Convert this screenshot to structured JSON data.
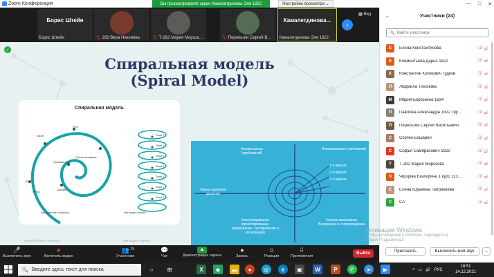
{
  "window": {
    "title": "Zoom Конференция",
    "share_banner": "Вы просматриваете экран Камалетдиновы Эля 1822",
    "view_options": "Настройки просмотра ⌄",
    "controls": [
      "—",
      "□",
      "✕"
    ]
  },
  "strip": {
    "tiles": [
      {
        "big": "Борис Штейн",
        "caption": "Борис Штейн",
        "muted": false,
        "kind": "name"
      },
      {
        "big": "",
        "caption": "282 Вера Никонова",
        "muted": true,
        "kind": "face",
        "color": "#7a3b2e"
      },
      {
        "big": "",
        "caption": "Т-282 Мария Морозо...",
        "muted": true,
        "kind": "face",
        "color": "#5c5b58"
      },
      {
        "big": "",
        "caption": "Перельгин Сергей В...",
        "muted": true,
        "kind": "face",
        "color": "#556b55"
      },
      {
        "big": "Камалетдинова...",
        "caption": "Камалетдинова Эля 1822",
        "muted": false,
        "kind": "name"
      }
    ],
    "view_label": "Вид"
  },
  "slide": {
    "title_line1": "Спиральная модель",
    "title_line2": "(Spiral Model)",
    "left_card": {
      "title": "Спиральная модель",
      "spiral_labels": [
        "Тест",
        "Зачёт",
        "Проектирование",
        "Требования",
        "Дизайн",
        "HTML",
        "JS"
      ],
      "coil_labels": [
        "Этап 7",
        "Этап 6",
        "Этап 5",
        "Этап 4",
        "Этап 3",
        "Этап 2",
        "Этап 1"
      ],
      "caption_left": "Как работает юзнутра",
      "caption_right": "Как видит клиент"
    },
    "right_card": {
      "top_left": "Анализ риска (требований)",
      "top_right": "Формирование требований",
      "versions": [
        "1-я версия",
        "2-я версия",
        "3-я версия"
      ],
      "left": "Линия принятия решения",
      "bottom_left": "Конструирование (проектирование, кодирование, тестирование и интеграция)",
      "bottom_right": "Оценка заказчиком. Внедрение и сопровождение"
    },
    "footer_left": "как работаете изнутри",
    "footer_right": "как видит клиент"
  },
  "toolbar": {
    "items": [
      {
        "label": "Выключить звук",
        "icon": "🎤",
        "red": false
      },
      {
        "label": "Включить видео",
        "icon": "■",
        "red": true
      },
      {
        "label": "Участники",
        "icon": "👥",
        "red": false,
        "count": "24"
      },
      {
        "label": "Чат",
        "icon": "💬",
        "red": false
      },
      {
        "label": "Демонстрация экрана",
        "icon": "▲",
        "red": false,
        "green": true
      },
      {
        "label": "Запись",
        "icon": "●",
        "red": false
      },
      {
        "label": "Реакции",
        "icon": "☺",
        "red": false
      },
      {
        "label": "Приложения",
        "icon": "⁞⁞",
        "red": false
      }
    ],
    "leave": "Выйти"
  },
  "panel": {
    "title": "Участники (24)",
    "search_placeholder": "Найти участника",
    "participants": [
      {
        "initial": "Е",
        "name": "Елена Константинова",
        "color": "#e0591f",
        "photo": false
      },
      {
        "initial": "К",
        "name": "Клементьева Дарья 1822",
        "color": "#e0591f",
        "photo": false
      },
      {
        "initial": "К",
        "name": "Константин Климович Гудков",
        "color": "#8a6a4a",
        "photo": true
      },
      {
        "initial": "Л",
        "name": "Людмила Тихонова",
        "color": "#b7977a",
        "photo": true
      },
      {
        "initial": "М",
        "name": "Мария Березкина 1834",
        "color": "#3b3b3b",
        "photo": false
      },
      {
        "initial": "П",
        "name": "Павлова Александра 1822 тру...",
        "color": "#8a8076",
        "photo": true
      },
      {
        "initial": "П",
        "name": "Перельгин Сергей Васильевич",
        "color": "#6c5a48",
        "photo": true
      },
      {
        "initial": "С",
        "name": "Сергей Бошарин",
        "color": "#a47d63",
        "photo": true
      },
      {
        "initial": "С",
        "name": "Софья Самбрасович 1822",
        "color": "#e03a2a",
        "photo": false
      },
      {
        "initial": "Т",
        "name": "Т-282 Мария Морозова",
        "color": "#4a4440",
        "photo": true
      },
      {
        "initial": "Ч",
        "name": "Чирцова Екатерина 1 курс 113...",
        "color": "#e0591f",
        "photo": false
      },
      {
        "initial": "Е",
        "name": "Елена Юрьевна Патрикеева",
        "color": "#b89680",
        "photo": true
      },
      {
        "initial": "С",
        "name": "СА",
        "color": "#2aa442",
        "photo": false
      }
    ],
    "invite": "Пригласить",
    "mute_all": "Выключить мой звук",
    "more": "..."
  },
  "watermark": {
    "line1": "Активация Windows",
    "line2": "Чтобы активировать Windows, перейдите в",
    "line3": "раздел \"Параметры\"."
  },
  "taskbar": {
    "search_placeholder": "Введите здесь текст для поиска",
    "lang": "РУС",
    "time": "18:51",
    "date": "14.12.2021"
  }
}
